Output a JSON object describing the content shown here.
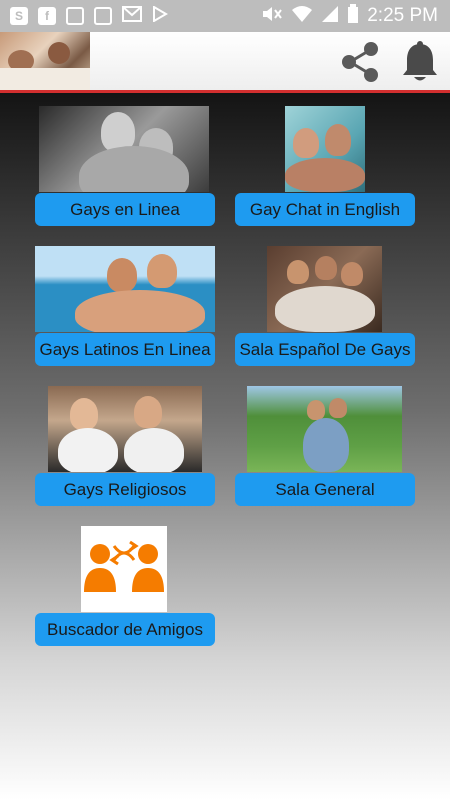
{
  "status_bar": {
    "time": "2:25 PM",
    "left_icons": [
      "s-notification-icon",
      "facebook-icon",
      "news-icon",
      "image-icon",
      "mail-icon",
      "play-store-icon"
    ]
  },
  "tiles": [
    {
      "label": "Gays en Linea"
    },
    {
      "label": "Gay Chat in English"
    },
    {
      "label": "Gays Latinos En Linea"
    },
    {
      "label": "Sala Español De Gays"
    },
    {
      "label": "Gays Religiosos"
    },
    {
      "label": "Sala General"
    },
    {
      "label": "Buscador de Amigos"
    }
  ],
  "colors": {
    "accent": "#1e9bf0",
    "appbar_border": "#d32f2f",
    "friends_icon": "#f57c00"
  }
}
